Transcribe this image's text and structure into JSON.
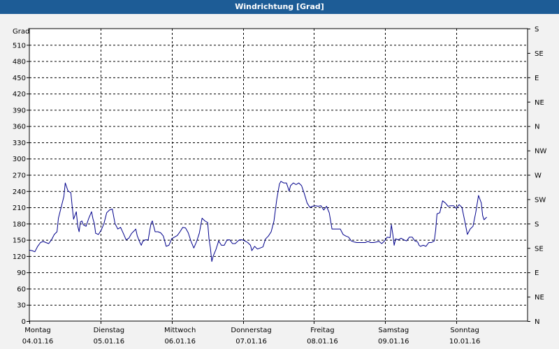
{
  "window": {
    "title": "Windrichtung [Grad]"
  },
  "chart_data": {
    "type": "line",
    "title": "Windrichtung [Grad]",
    "ylabel": "Grad",
    "ylim": [
      0,
      540
    ],
    "y_ticks": [
      0,
      30,
      60,
      90,
      120,
      150,
      180,
      210,
      240,
      270,
      300,
      330,
      360,
      390,
      420,
      450,
      480,
      510
    ],
    "right_axis_labels": [
      "N",
      "NE",
      "E",
      "SE",
      "S",
      "SW",
      "W",
      "NW",
      "N",
      "NE",
      "E",
      "SE",
      "S"
    ],
    "right_axis_values": [
      0,
      45,
      90,
      135,
      180,
      225,
      270,
      315,
      360,
      405,
      450,
      495,
      540
    ],
    "xlim": [
      0,
      7
    ],
    "x_categories": [
      {
        "day": "Montag",
        "date": "04.01.16"
      },
      {
        "day": "Dienstag",
        "date": "05.01.16"
      },
      {
        "day": "Mittwoch",
        "date": "06.01.16"
      },
      {
        "day": "Donnerstag",
        "date": "07.01.16"
      },
      {
        "day": "Freitag",
        "date": "08.01.16"
      },
      {
        "day": "Samstag",
        "date": "09.01.16"
      },
      {
        "day": "Sonntag",
        "date": "10.01.16"
      }
    ],
    "grid": true,
    "line_color": "#00008b",
    "series": [
      {
        "points": [
          [
            0.0,
            131
          ],
          [
            0.039,
            130
          ],
          [
            0.078,
            128
          ],
          [
            0.117,
            138
          ],
          [
            0.156,
            145
          ],
          [
            0.194,
            147
          ],
          [
            0.233,
            145
          ],
          [
            0.272,
            143
          ],
          [
            0.311,
            150
          ],
          [
            0.35,
            160
          ],
          [
            0.389,
            165
          ],
          [
            0.408,
            190
          ],
          [
            0.447,
            210
          ],
          [
            0.485,
            230
          ],
          [
            0.505,
            255
          ],
          [
            0.544,
            240
          ],
          [
            0.583,
            237
          ],
          [
            0.602,
            212
          ],
          [
            0.621,
            188
          ],
          [
            0.66,
            202
          ],
          [
            0.68,
            175
          ],
          [
            0.699,
            165
          ],
          [
            0.718,
            183
          ],
          [
            0.738,
            185
          ],
          [
            0.757,
            178
          ],
          [
            0.796,
            175
          ],
          [
            0.835,
            190
          ],
          [
            0.874,
            202
          ],
          [
            0.893,
            189
          ],
          [
            0.913,
            180
          ],
          [
            0.932,
            162
          ],
          [
            0.971,
            160
          ],
          [
            1.01,
            168
          ],
          [
            1.049,
            180
          ],
          [
            1.087,
            200
          ],
          [
            1.126,
            205
          ],
          [
            1.165,
            207
          ],
          [
            1.204,
            180
          ],
          [
            1.243,
            170
          ],
          [
            1.282,
            173
          ],
          [
            1.32,
            162
          ],
          [
            1.359,
            150
          ],
          [
            1.398,
            153
          ],
          [
            1.437,
            162
          ],
          [
            1.476,
            167
          ],
          [
            1.495,
            170
          ],
          [
            1.515,
            158
          ],
          [
            1.553,
            145
          ],
          [
            1.573,
            140
          ],
          [
            1.592,
            147
          ],
          [
            1.631,
            150
          ],
          [
            1.67,
            150
          ],
          [
            1.689,
            165
          ],
          [
            1.709,
            180
          ],
          [
            1.728,
            185
          ],
          [
            1.767,
            165
          ],
          [
            1.806,
            165
          ],
          [
            1.845,
            163
          ],
          [
            1.883,
            157
          ],
          [
            1.922,
            138
          ],
          [
            1.961,
            140
          ],
          [
            2.0,
            152
          ],
          [
            2.039,
            155
          ],
          [
            2.078,
            158
          ],
          [
            2.117,
            165
          ],
          [
            2.155,
            173
          ],
          [
            2.194,
            172
          ],
          [
            2.233,
            163
          ],
          [
            2.272,
            147
          ],
          [
            2.311,
            135
          ],
          [
            2.35,
            147
          ],
          [
            2.388,
            162
          ],
          [
            2.427,
            190
          ],
          [
            2.466,
            185
          ],
          [
            2.505,
            182
          ],
          [
            2.524,
            152
          ],
          [
            2.544,
            135
          ],
          [
            2.563,
            110
          ],
          [
            2.583,
            120
          ],
          [
            2.621,
            132
          ],
          [
            2.66,
            148
          ],
          [
            2.699,
            140
          ],
          [
            2.738,
            140
          ],
          [
            2.777,
            150
          ],
          [
            2.816,
            150
          ],
          [
            2.854,
            143
          ],
          [
            2.893,
            143
          ],
          [
            2.932,
            148
          ],
          [
            2.951,
            150
          ],
          [
            2.99,
            150
          ],
          [
            3.029,
            148
          ],
          [
            3.068,
            145
          ],
          [
            3.107,
            140
          ],
          [
            3.126,
            130
          ],
          [
            3.165,
            138
          ],
          [
            3.204,
            133
          ],
          [
            3.243,
            135
          ],
          [
            3.282,
            137
          ],
          [
            3.32,
            152
          ],
          [
            3.359,
            157
          ],
          [
            3.398,
            165
          ],
          [
            3.437,
            185
          ],
          [
            3.476,
            225
          ],
          [
            3.514,
            253
          ],
          [
            3.534,
            258
          ],
          [
            3.573,
            255
          ],
          [
            3.612,
            255
          ],
          [
            3.631,
            248
          ],
          [
            3.65,
            240
          ],
          [
            3.67,
            250
          ],
          [
            3.709,
            255
          ],
          [
            3.748,
            252
          ],
          [
            3.786,
            255
          ],
          [
            3.825,
            250
          ],
          [
            3.864,
            235
          ],
          [
            3.903,
            218
          ],
          [
            3.942,
            210
          ],
          [
            3.981,
            212
          ],
          [
            4.019,
            213
          ],
          [
            4.058,
            212
          ],
          [
            4.097,
            213
          ],
          [
            4.136,
            205
          ],
          [
            4.175,
            212
          ],
          [
            4.214,
            200
          ],
          [
            4.252,
            170
          ],
          [
            4.291,
            170
          ],
          [
            4.33,
            170
          ],
          [
            4.369,
            170
          ],
          [
            4.408,
            160
          ],
          [
            4.447,
            157
          ],
          [
            4.485,
            155
          ],
          [
            4.524,
            148
          ],
          [
            4.563,
            146
          ],
          [
            4.602,
            145
          ],
          [
            4.641,
            145
          ],
          [
            4.68,
            145
          ],
          [
            4.718,
            145
          ],
          [
            4.757,
            147
          ],
          [
            4.796,
            145
          ],
          [
            4.835,
            145
          ],
          [
            4.874,
            146
          ],
          [
            4.913,
            147
          ],
          [
            4.951,
            143
          ],
          [
            4.99,
            148
          ],
          [
            5.029,
            155
          ],
          [
            5.068,
            154
          ],
          [
            5.087,
            178
          ],
          [
            5.107,
            160
          ],
          [
            5.126,
            140
          ],
          [
            5.146,
            152
          ],
          [
            5.184,
            150
          ],
          [
            5.223,
            153
          ],
          [
            5.262,
            150
          ],
          [
            5.301,
            148
          ],
          [
            5.34,
            155
          ],
          [
            5.379,
            155
          ],
          [
            5.417,
            148
          ],
          [
            5.456,
            146
          ],
          [
            5.476,
            140
          ],
          [
            5.495,
            138
          ],
          [
            5.534,
            140
          ],
          [
            5.573,
            138
          ],
          [
            5.612,
            145
          ],
          [
            5.65,
            145
          ],
          [
            5.689,
            148
          ],
          [
            5.709,
            168
          ],
          [
            5.728,
            198
          ],
          [
            5.767,
            200
          ],
          [
            5.806,
            222
          ],
          [
            5.845,
            218
          ],
          [
            5.883,
            212
          ],
          [
            5.922,
            213
          ],
          [
            5.961,
            213
          ],
          [
            6.0,
            208
          ],
          [
            6.039,
            215
          ],
          [
            6.078,
            210
          ],
          [
            6.117,
            185
          ],
          [
            6.155,
            160
          ],
          [
            6.194,
            170
          ],
          [
            6.233,
            175
          ],
          [
            6.272,
            200
          ],
          [
            6.311,
            232
          ],
          [
            6.35,
            218
          ],
          [
            6.369,
            195
          ],
          [
            6.388,
            187
          ],
          [
            6.427,
            192
          ]
        ]
      }
    ]
  }
}
